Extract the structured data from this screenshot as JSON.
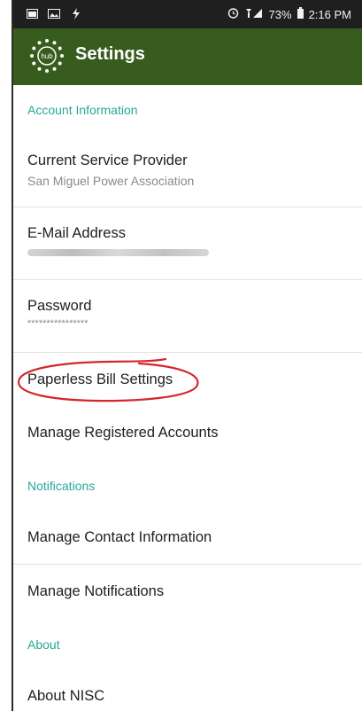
{
  "status_bar": {
    "left_icons": [
      "image-icon",
      "image-icon",
      "flash-icon"
    ],
    "alarm_icon": "alarm-icon",
    "signal_icon": "signal-icon",
    "battery_icon": "battery-icon",
    "battery": "73%",
    "time": "2:16 PM"
  },
  "header": {
    "logo_text": "hub",
    "title": "Settings",
    "colors": {
      "bar": "#385b1e",
      "accent": "#27a79a"
    }
  },
  "sections": {
    "account": "Account Information",
    "notifications": "Notifications",
    "about": "About"
  },
  "items": {
    "provider": {
      "title": "Current Service Provider",
      "subtitle": "San Miguel Power Association"
    },
    "email": {
      "title": "E-Mail Address"
    },
    "password": {
      "title": "Password",
      "value": "****************"
    },
    "paperless": {
      "title": "Paperless Bill Settings"
    },
    "registered": {
      "title": "Manage Registered Accounts"
    },
    "contact": {
      "title": "Manage Contact Information"
    },
    "manage_notifications": {
      "title": "Manage Notifications"
    },
    "about_nisc": {
      "title": "About NISC"
    }
  }
}
